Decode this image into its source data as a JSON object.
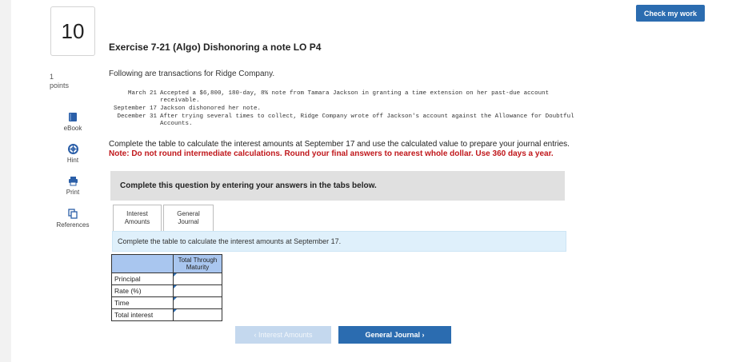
{
  "header": {
    "check_label": "Check my work"
  },
  "question": {
    "number": "10",
    "points_value": "1",
    "points_label": "points"
  },
  "tools": [
    {
      "label": "eBook",
      "icon": "book-icon"
    },
    {
      "label": "Hint",
      "icon": "lifebuoy-icon"
    },
    {
      "label": "Print",
      "icon": "printer-icon"
    },
    {
      "label": "References",
      "icon": "copy-icon"
    }
  ],
  "exercise": {
    "title": "Exercise 7-21 (Algo) Dishonoring a note LO P4",
    "intro": "Following are transactions for Ridge Company.",
    "transactions": [
      {
        "date": "March 21",
        "text": "Accepted a $6,800, 180-day, 8% note from Tamara Jackson in granting a time extension on her past-due account",
        "text2": "receivable."
      },
      {
        "date": "September 17",
        "text": "Jackson dishonored her note.",
        "text2": ""
      },
      {
        "date": "December 31",
        "text": "After trying several times to collect, Ridge Company wrote off Jackson's account against the Allowance for Doubtful",
        "text2": "Accounts."
      }
    ],
    "instruction": "Complete the table to calculate the interest amounts at September 17 and use the calculated value to prepare your journal entries.",
    "note": "Note: Do not round intermediate calculations. Round your final answers to nearest whole dollar. Use 360 days a year."
  },
  "banner": "Complete this question by entering your answers in the tabs below.",
  "tabs": [
    {
      "line1": "Interest",
      "line2": "Amounts"
    },
    {
      "line1": "General",
      "line2": "Journal"
    }
  ],
  "subinstruction": "Complete the table to calculate the interest amounts at September 17.",
  "table": {
    "column_header": "Total Through Maturity",
    "rows": [
      {
        "label": "Principal",
        "value": ""
      },
      {
        "label": "Rate (%)",
        "value": ""
      },
      {
        "label": "Time",
        "value": ""
      },
      {
        "label": "Total interest",
        "value": ""
      }
    ]
  },
  "nav": {
    "prev_label": "Interest Amounts",
    "next_label": "General Journal"
  }
}
